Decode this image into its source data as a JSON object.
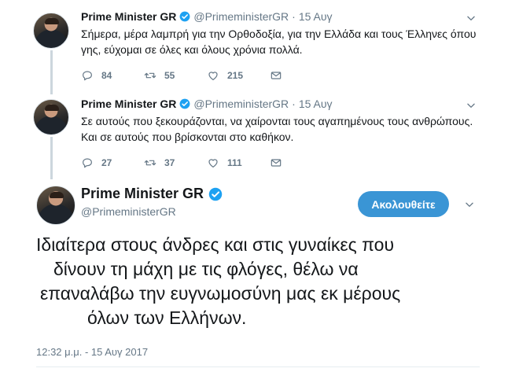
{
  "account": {
    "name": "Prime Minister GR",
    "handle": "@PrimeministerGR"
  },
  "tweets": [
    {
      "date": "15 Αυγ",
      "text_line1": "Σήμερα, μέρα λαμπρή για την Ορθοδοξία, για την Ελλάδα και τους Έλληνες όπου",
      "text_line2": "γης, εύχομαι σε όλες και όλους χρόνια πολλά.",
      "replies": "84",
      "retweets": "55",
      "likes": "215"
    },
    {
      "date": "15 Αυγ",
      "text_line1": "Σε αυτούς που ξεκουράζονται, να χαίρονται τους αγαπημένους τους ανθρώπους.",
      "text_line2": "Και σε αυτούς που βρίσκονται στο καθήκον.",
      "replies": "27",
      "retweets": "37",
      "likes": "111"
    }
  ],
  "main_tweet": {
    "follow_label": "Ακολουθείτε",
    "text_line1": "Ιδιαίτερα στους άνδρες και στις γυναίκες που",
    "text_line2": "δίνουν τη μάχη με τις φλόγες, θέλω να",
    "text_line3": "επαναλάβω την ευγνωμοσύνη μας εκ μέρους",
    "text_line4": "όλων των Ελλήνων.",
    "timestamp": "12:32 μ.μ. - 15 Αυγ 2017"
  },
  "icons": {
    "verified": "verified-badge-icon",
    "menu": "chevron-down-icon",
    "reply": "reply-icon",
    "retweet": "retweet-icon",
    "like": "heart-icon",
    "dm": "envelope-icon"
  },
  "colors": {
    "accent": "#1da1f2",
    "follow_button": "#3a95d5",
    "secondary_text": "#657786",
    "thread_line": "#ccd6dd"
  }
}
